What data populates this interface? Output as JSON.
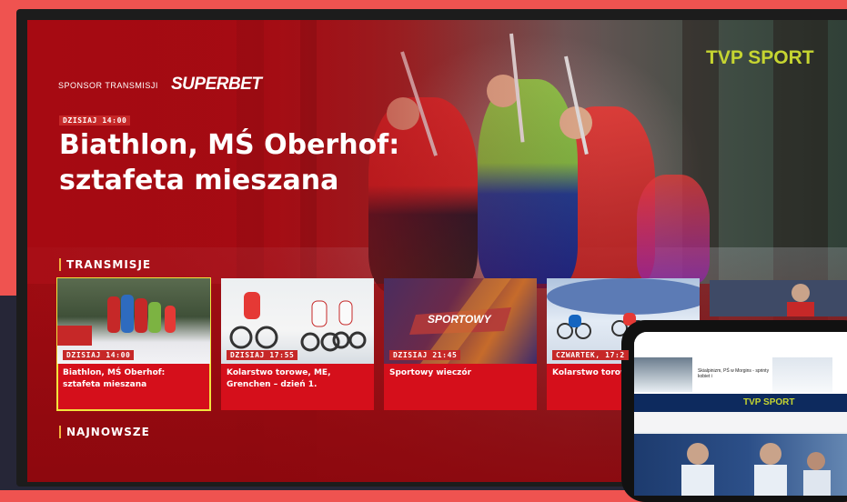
{
  "sponsor": {
    "label": "SPONSOR TRANSMISJI",
    "name": "SUPERBET"
  },
  "brand": "TVP SPORT",
  "hero": {
    "badge": "DZISIAJ 14:00",
    "title": "Biathlon, MŚ Oberhof: sztafeta mieszana"
  },
  "sections": {
    "transmisje": "TRANSMISJE",
    "najnowsze": "NAJNOWSZE"
  },
  "cards": [
    {
      "badge": "DZISIAJ 14:00",
      "title": "Biathlon, MŚ Oberhof: sztafeta mieszana",
      "selected": true
    },
    {
      "badge": "DZISIAJ 17:55",
      "title": "Kolarstwo torowe, ME, Grenchen – dzień 1."
    },
    {
      "badge": "DZISIAJ 21:45",
      "title": "Sportowy wieczór",
      "logo": "SPORTOWY"
    },
    {
      "badge": "CZWARTEK, 17:2",
      "title": "Kolarstwo torowe dzień 2."
    }
  ],
  "phone": {
    "brand": "TVP SPORT",
    "tile_text": "Skialpinizm, PŚ w Morgins - sprinty kobiet i"
  },
  "colors": {
    "accent": "#c6d531",
    "red": "#d50f1b",
    "highlight": "#f2e33d"
  }
}
